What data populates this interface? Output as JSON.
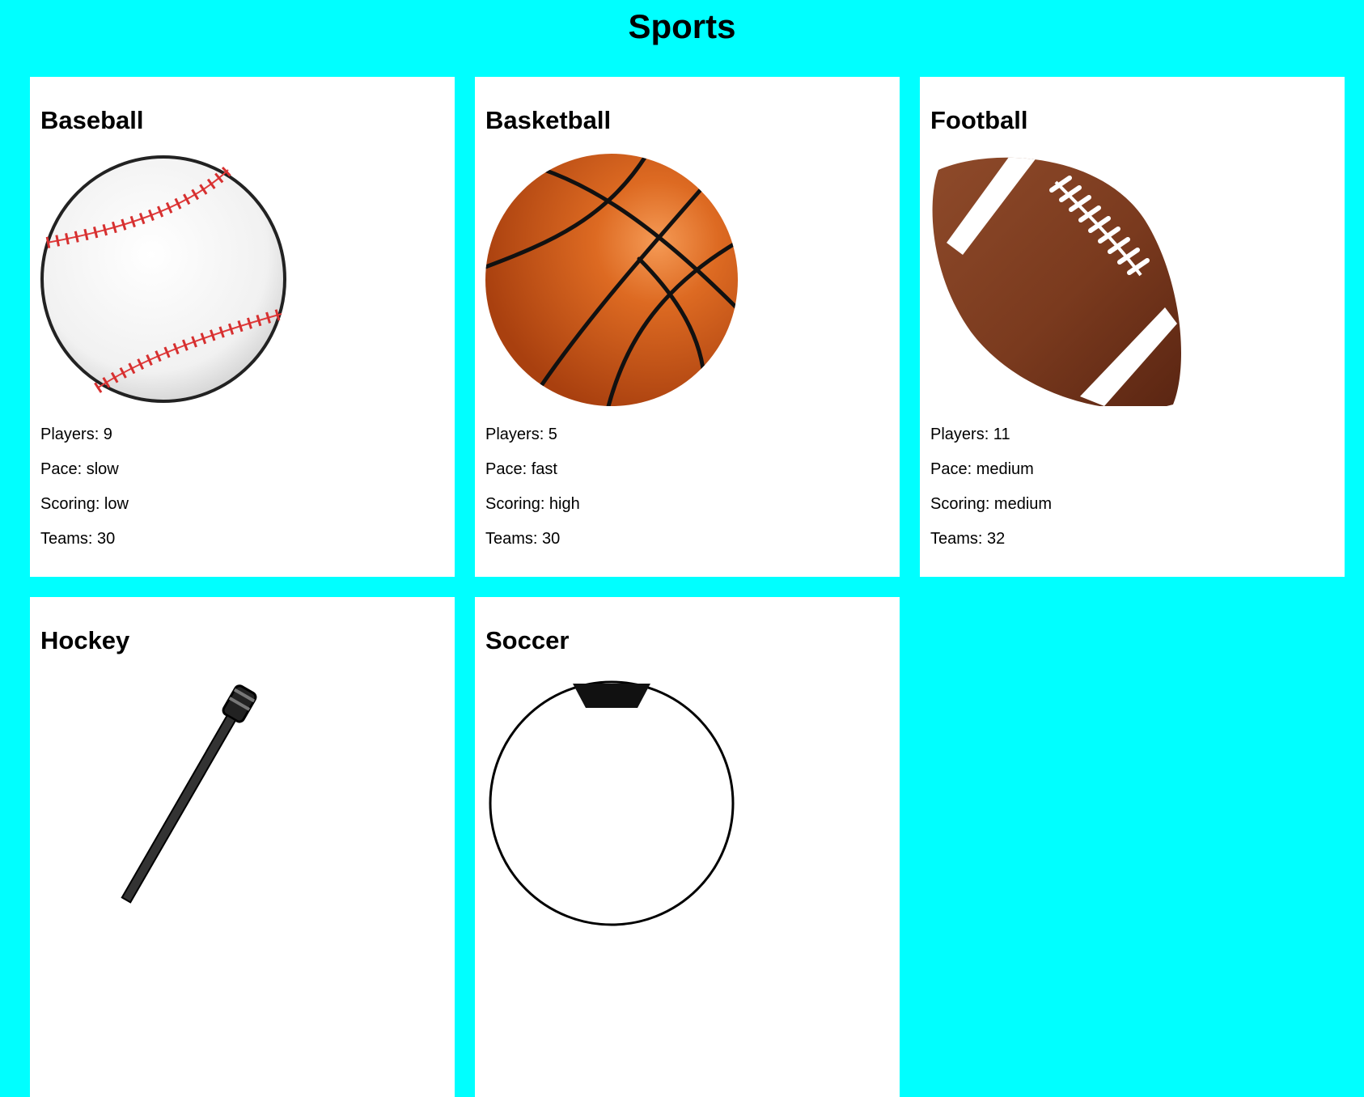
{
  "page": {
    "title": "Sports"
  },
  "cards": [
    {
      "name": "Baseball",
      "icon": "baseball-icon",
      "players": "Players: 9",
      "pace": "Pace: slow",
      "scoring": "Scoring: low",
      "teams": "Teams: 30"
    },
    {
      "name": "Basketball",
      "icon": "basketball-icon",
      "players": "Players: 5",
      "pace": "Pace: fast",
      "scoring": "Scoring: high",
      "teams": "Teams: 30"
    },
    {
      "name": "Football",
      "icon": "football-icon",
      "players": "Players: 11",
      "pace": "Pace: medium",
      "scoring": "Scoring: medium",
      "teams": "Teams: 32"
    },
    {
      "name": "Hockey",
      "icon": "hockey-stick-icon"
    },
    {
      "name": "Soccer",
      "icon": "soccer-ball-icon"
    }
  ],
  "colors": {
    "background": "#00ffff",
    "card": "#ffffff"
  }
}
